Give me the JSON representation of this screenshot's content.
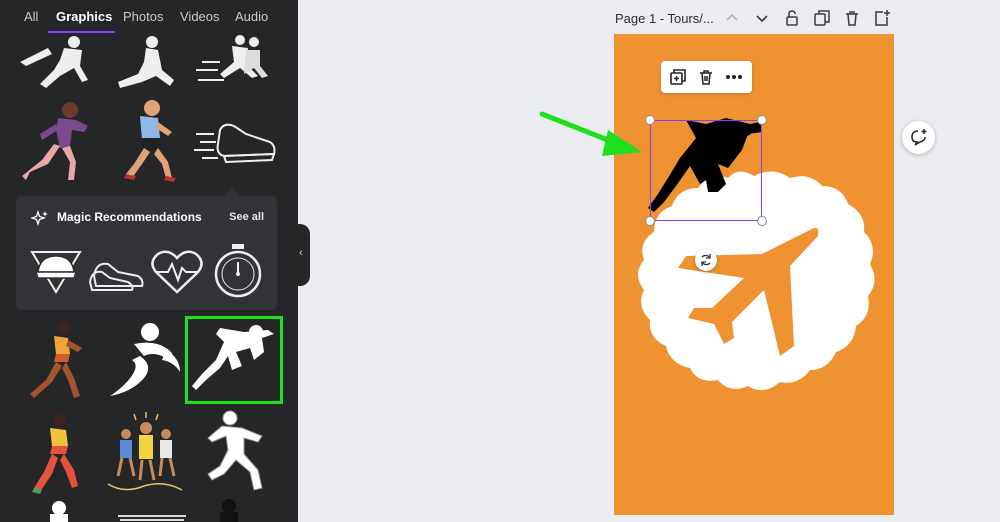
{
  "sidebar": {
    "tabs": [
      {
        "label": "All"
      },
      {
        "label": "Graphics"
      },
      {
        "label": "Photos"
      },
      {
        "label": "Videos"
      },
      {
        "label": "Audio"
      }
    ],
    "active_tab": "Graphics",
    "magic": {
      "title": "Magic Recommendations",
      "see_all": "See all"
    }
  },
  "header": {
    "page_title": "Page 1 - Tours/..."
  },
  "colors": {
    "canvas_bg": "#ef9332",
    "highlight": "#1ee01e",
    "selection": "#8b3dff",
    "sidebar_bg": "#252627"
  },
  "icons": {
    "toolbar": [
      "chevron-up-icon",
      "chevron-down-icon",
      "unlock-icon",
      "duplicate-page-icon",
      "trash-icon",
      "add-page-icon"
    ],
    "float_toolbar": [
      "duplicate-icon",
      "trash-icon",
      "more-icon"
    ],
    "canvas": [
      "runner-silhouette",
      "airplane-icon",
      "rotate-icon",
      "comment-add-icon"
    ]
  }
}
